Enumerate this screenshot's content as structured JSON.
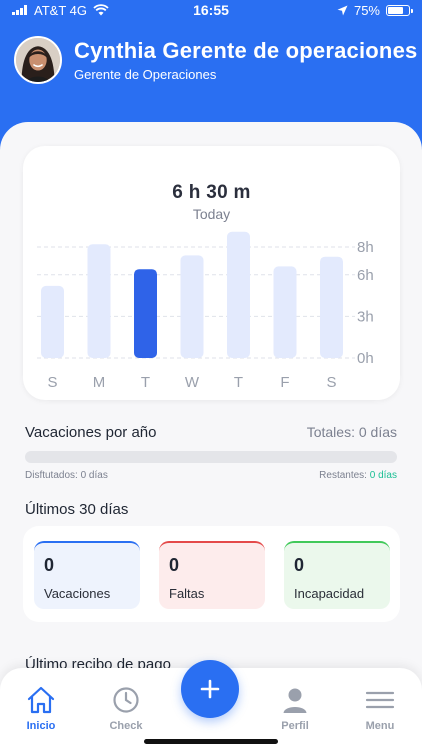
{
  "status_bar": {
    "carrier": "AT&T 4G",
    "time": "16:55",
    "battery": "75%"
  },
  "profile": {
    "name": "Cynthia Gerente de operaciones",
    "role": "Gerente de Operaciones"
  },
  "chart": {
    "headline": "6 h 30 m",
    "subtitle": "Today"
  },
  "chart_data": {
    "type": "bar",
    "categories": [
      "S",
      "M",
      "T",
      "W",
      "T",
      "F",
      "S"
    ],
    "values": [
      5.2,
      8.2,
      6.4,
      7.4,
      9.1,
      6.6,
      7.3
    ],
    "highlight_index": 2,
    "y_ticks": [
      "8h",
      "6h",
      "3h",
      "0h"
    ],
    "colors": {
      "bar": "#e3eafd",
      "highlight": "#2f63e8"
    }
  },
  "vacaciones": {
    "title": "Vacaciones por año",
    "totales": "Totales: 0 días",
    "progress": 0,
    "disfrutados": "Disftutados: 0 días",
    "restantes_label": "Restantes: ",
    "restantes_value": "0 días"
  },
  "ultimos": {
    "title": "Últimos 30 días",
    "stats": [
      {
        "value": "0",
        "label": "Vacaciones",
        "color": "#2a6ff2"
      },
      {
        "value": "0",
        "label": "Faltas",
        "color": "#e44a4a"
      },
      {
        "value": "0",
        "label": "Incapacidad",
        "color": "#41c95a"
      }
    ]
  },
  "receipt": {
    "title": "Último recibo de pago"
  },
  "tabbar": {
    "items": [
      {
        "label": "Inicio",
        "icon": "home-icon",
        "active": true
      },
      {
        "label": "Check",
        "icon": "clock-icon",
        "active": false
      },
      {
        "label": "Perfil",
        "icon": "user-icon",
        "active": false
      },
      {
        "label": "Menu",
        "icon": "menu-icon",
        "active": false
      }
    ],
    "fab_icon": "plus-icon"
  }
}
